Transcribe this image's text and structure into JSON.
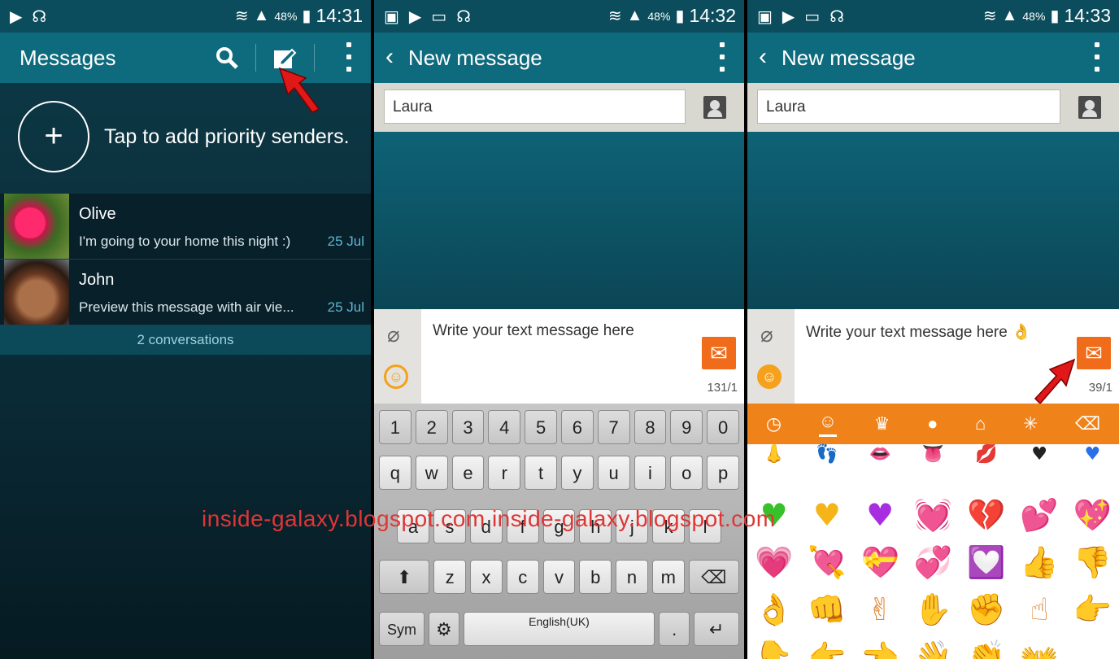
{
  "panel1": {
    "status": {
      "time": "14:31",
      "battery": "48%"
    },
    "title": "Messages",
    "priority_text": "Tap to add priority senders.",
    "conversations": [
      {
        "name": "Olive",
        "preview": "I'm going to your home this night :)",
        "date": "25 Jul"
      },
      {
        "name": "John",
        "preview": "Preview this message with air vie...",
        "date": "25 Jul"
      }
    ],
    "count": "2 conversations"
  },
  "panel2": {
    "status": {
      "time": "14:32",
      "battery": "48%"
    },
    "title": "New message",
    "recipient": "Laura",
    "message": "Write your text message here",
    "counter": "131/1",
    "keys": {
      "row1": [
        "1",
        "2",
        "3",
        "4",
        "5",
        "6",
        "7",
        "8",
        "9",
        "0"
      ],
      "row2": [
        "q",
        "w",
        "e",
        "r",
        "t",
        "y",
        "u",
        "i",
        "o",
        "p"
      ],
      "row3": [
        "a",
        "s",
        "d",
        "f",
        "g",
        "h",
        "j",
        "k",
        "l"
      ],
      "row4": [
        "z",
        "x",
        "c",
        "v",
        "b",
        "n",
        "m"
      ],
      "sym": "Sym",
      "space": "English(UK)",
      "period": "."
    }
  },
  "panel3": {
    "status": {
      "time": "14:33",
      "battery": "48%"
    },
    "title": "New message",
    "recipient": "Laura",
    "message": "Write your text message here 👌",
    "counter": "39/1"
  },
  "watermark": "inside-galaxy.blogspot.com inside-galaxy.blogspot.com",
  "colors": {
    "appbar": "#0e6a7d",
    "accent": "#f06b1a",
    "arrow": "#e01818"
  }
}
